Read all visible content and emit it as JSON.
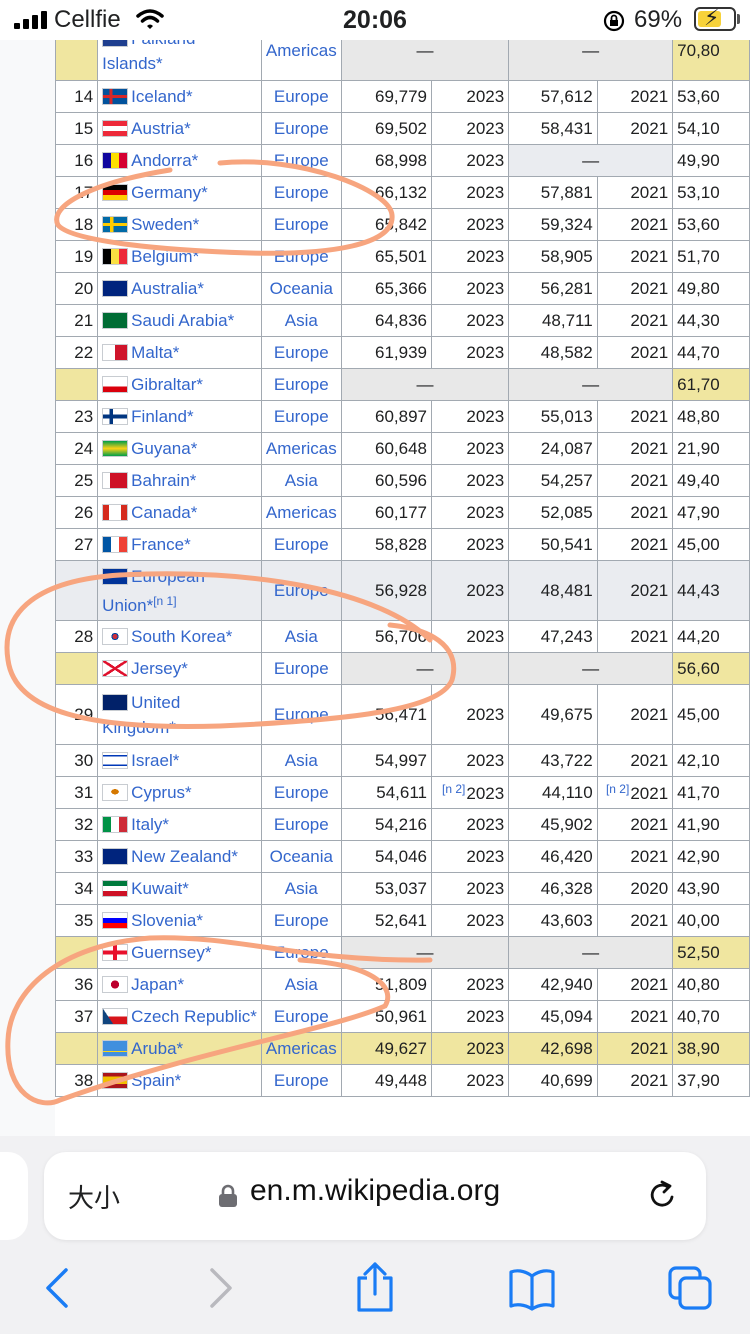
{
  "status_bar": {
    "carrier": "Cellfie",
    "time": "20:06",
    "battery_percent": "69%",
    "battery_level": 0.69,
    "icons": [
      "signal-icon",
      "wifi-icon",
      "orientation-lock-icon",
      "battery-charging-icon"
    ]
  },
  "table": {
    "rows": [
      {
        "rank": "",
        "country": "Falkland Islands",
        "flag": "fk",
        "region": "Americas",
        "imf": "—",
        "imf_year": "",
        "wb": "—",
        "wb_year": "",
        "last": "70,80",
        "kind": "territory",
        "wrap": true
      },
      {
        "rank": "14",
        "country": "Iceland",
        "flag": "is",
        "region": "Europe",
        "imf": "69,779",
        "imf_year": "2023",
        "wb": "57,612",
        "wb_year": "2021",
        "last": "53,60"
      },
      {
        "rank": "15",
        "country": "Austria",
        "flag": "at",
        "region": "Europe",
        "imf": "69,502",
        "imf_year": "2023",
        "wb": "58,431",
        "wb_year": "2021",
        "last": "54,10"
      },
      {
        "rank": "16",
        "country": "Andorra",
        "flag": "ad",
        "region": "Europe",
        "imf": "68,998",
        "imf_year": "2023",
        "wb": "—",
        "wb_year": "",
        "last": "49,90",
        "kind": "gray"
      },
      {
        "rank": "17",
        "country": "Germany",
        "flag": "de",
        "region": "Europe",
        "imf": "66,132",
        "imf_year": "2023",
        "wb": "57,881",
        "wb_year": "2021",
        "last": "53,10"
      },
      {
        "rank": "18",
        "country": "Sweden",
        "flag": "se",
        "region": "Europe",
        "imf": "65,842",
        "imf_year": "2023",
        "wb": "59,324",
        "wb_year": "2021",
        "last": "53,60"
      },
      {
        "rank": "19",
        "country": "Belgium",
        "flag": "be",
        "region": "Europe",
        "imf": "65,501",
        "imf_year": "2023",
        "wb": "58,905",
        "wb_year": "2021",
        "last": "51,70"
      },
      {
        "rank": "20",
        "country": "Australia",
        "flag": "au",
        "region": "Oceania",
        "imf": "65,366",
        "imf_year": "2023",
        "wb": "56,281",
        "wb_year": "2021",
        "last": "49,80"
      },
      {
        "rank": "21",
        "country": "Saudi Arabia",
        "flag": "sa",
        "region": "Asia",
        "imf": "64,836",
        "imf_year": "2023",
        "wb": "48,711",
        "wb_year": "2021",
        "last": "44,30"
      },
      {
        "rank": "22",
        "country": "Malta",
        "flag": "mt",
        "region": "Europe",
        "imf": "61,939",
        "imf_year": "2023",
        "wb": "48,582",
        "wb_year": "2021",
        "last": "44,70"
      },
      {
        "rank": "",
        "country": "Gibraltar",
        "flag": "gi",
        "region": "Europe",
        "imf": "—",
        "imf_year": "",
        "wb": "—",
        "wb_year": "",
        "last": "61,70",
        "kind": "territory"
      },
      {
        "rank": "23",
        "country": "Finland",
        "flag": "fi",
        "region": "Europe",
        "imf": "60,897",
        "imf_year": "2023",
        "wb": "55,013",
        "wb_year": "2021",
        "last": "48,80"
      },
      {
        "rank": "24",
        "country": "Guyana",
        "flag": "gy",
        "region": "Americas",
        "imf": "60,648",
        "imf_year": "2023",
        "wb": "24,087",
        "wb_year": "2021",
        "last": "21,90"
      },
      {
        "rank": "25",
        "country": "Bahrain",
        "flag": "bh",
        "region": "Asia",
        "imf": "60,596",
        "imf_year": "2023",
        "wb": "54,257",
        "wb_year": "2021",
        "last": "49,40"
      },
      {
        "rank": "26",
        "country": "Canada",
        "flag": "ca",
        "region": "Americas",
        "imf": "60,177",
        "imf_year": "2023",
        "wb": "52,085",
        "wb_year": "2021",
        "last": "47,90"
      },
      {
        "rank": "27",
        "country": "France",
        "flag": "fr",
        "region": "Europe",
        "imf": "58,828",
        "imf_year": "2023",
        "wb": "50,541",
        "wb_year": "2021",
        "last": "45,00"
      },
      {
        "rank": "",
        "country": "European Union",
        "flag": "eu",
        "region": "Europe",
        "imf": "56,928",
        "imf_year": "2023",
        "wb": "48,481",
        "wb_year": "2021",
        "last": "44,43",
        "kind": "aggregate",
        "wrap": true,
        "note": "[n 1]"
      },
      {
        "rank": "28",
        "country": "South Korea",
        "flag": "kr",
        "region": "Asia",
        "imf": "56,706",
        "imf_year": "2023",
        "wb": "47,243",
        "wb_year": "2021",
        "last": "44,20"
      },
      {
        "rank": "",
        "country": "Jersey",
        "flag": "je",
        "region": "Europe",
        "imf": "—",
        "imf_year": "",
        "wb": "—",
        "wb_year": "",
        "last": "56,60",
        "kind": "territory"
      },
      {
        "rank": "29",
        "country": "United Kingdom",
        "flag": "gb",
        "region": "Europe",
        "imf": "56,471",
        "imf_year": "2023",
        "wb": "49,675",
        "wb_year": "2021",
        "last": "45,00",
        "wrap": true
      },
      {
        "rank": "30",
        "country": "Israel",
        "flag": "il",
        "region": "Asia",
        "imf": "54,997",
        "imf_year": "2023",
        "wb": "43,722",
        "wb_year": "2021",
        "last": "42,10"
      },
      {
        "rank": "31",
        "country": "Cyprus",
        "flag": "cy",
        "region": "Europe",
        "imf": "54,611",
        "imf_year": "2023",
        "wb": "44,110",
        "wb_year": "2021",
        "last": "41,70",
        "imf_note": "[n 2]",
        "wb_note": "[n 2]"
      },
      {
        "rank": "32",
        "country": "Italy",
        "flag": "it",
        "region": "Europe",
        "imf": "54,216",
        "imf_year": "2023",
        "wb": "45,902",
        "wb_year": "2021",
        "last": "41,90"
      },
      {
        "rank": "33",
        "country": "New Zealand",
        "flag": "nz",
        "region": "Oceania",
        "imf": "54,046",
        "imf_year": "2023",
        "wb": "46,420",
        "wb_year": "2021",
        "last": "42,90"
      },
      {
        "rank": "34",
        "country": "Kuwait",
        "flag": "kw",
        "region": "Asia",
        "imf": "53,037",
        "imf_year": "2023",
        "wb": "46,328",
        "wb_year": "2020",
        "last": "43,90"
      },
      {
        "rank": "35",
        "country": "Slovenia",
        "flag": "si",
        "region": "Europe",
        "imf": "52,641",
        "imf_year": "2023",
        "wb": "43,603",
        "wb_year": "2021",
        "last": "40,00"
      },
      {
        "rank": "",
        "country": "Guernsey",
        "flag": "gg",
        "region": "Europe",
        "imf": "—",
        "imf_year": "",
        "wb": "—",
        "wb_year": "",
        "last": "52,50",
        "kind": "territory"
      },
      {
        "rank": "36",
        "country": "Japan",
        "flag": "jp",
        "region": "Asia",
        "imf": "51,809",
        "imf_year": "2023",
        "wb": "42,940",
        "wb_year": "2021",
        "last": "40,80"
      },
      {
        "rank": "37",
        "country": "Czech Republic",
        "flag": "cz",
        "region": "Europe",
        "imf": "50,961",
        "imf_year": "2023",
        "wb": "45,094",
        "wb_year": "2021",
        "last": "40,70"
      },
      {
        "rank": "",
        "country": "Aruba",
        "flag": "aw",
        "region": "Americas",
        "imf": "49,627",
        "imf_year": "2023",
        "wb": "42,698",
        "wb_year": "2021",
        "last": "38,90",
        "kind": "aruba"
      },
      {
        "rank": "38",
        "country": "Spain",
        "flag": "es",
        "region": "Europe",
        "imf": "49,448",
        "imf_year": "2023",
        "wb": "40,699",
        "wb_year": "2021",
        "last": "37,90"
      }
    ],
    "asterisk": "*",
    "link_color": "#3366cc",
    "territory_color": "#f0e6a0",
    "annotation_color": "#f7a57f"
  },
  "toolbar": {
    "text_size_label": "大小",
    "url": "en.m.wikipedia.org",
    "buttons": [
      "back-icon",
      "forward-icon",
      "share-icon",
      "bookmarks-icon",
      "tabs-icon"
    ]
  }
}
